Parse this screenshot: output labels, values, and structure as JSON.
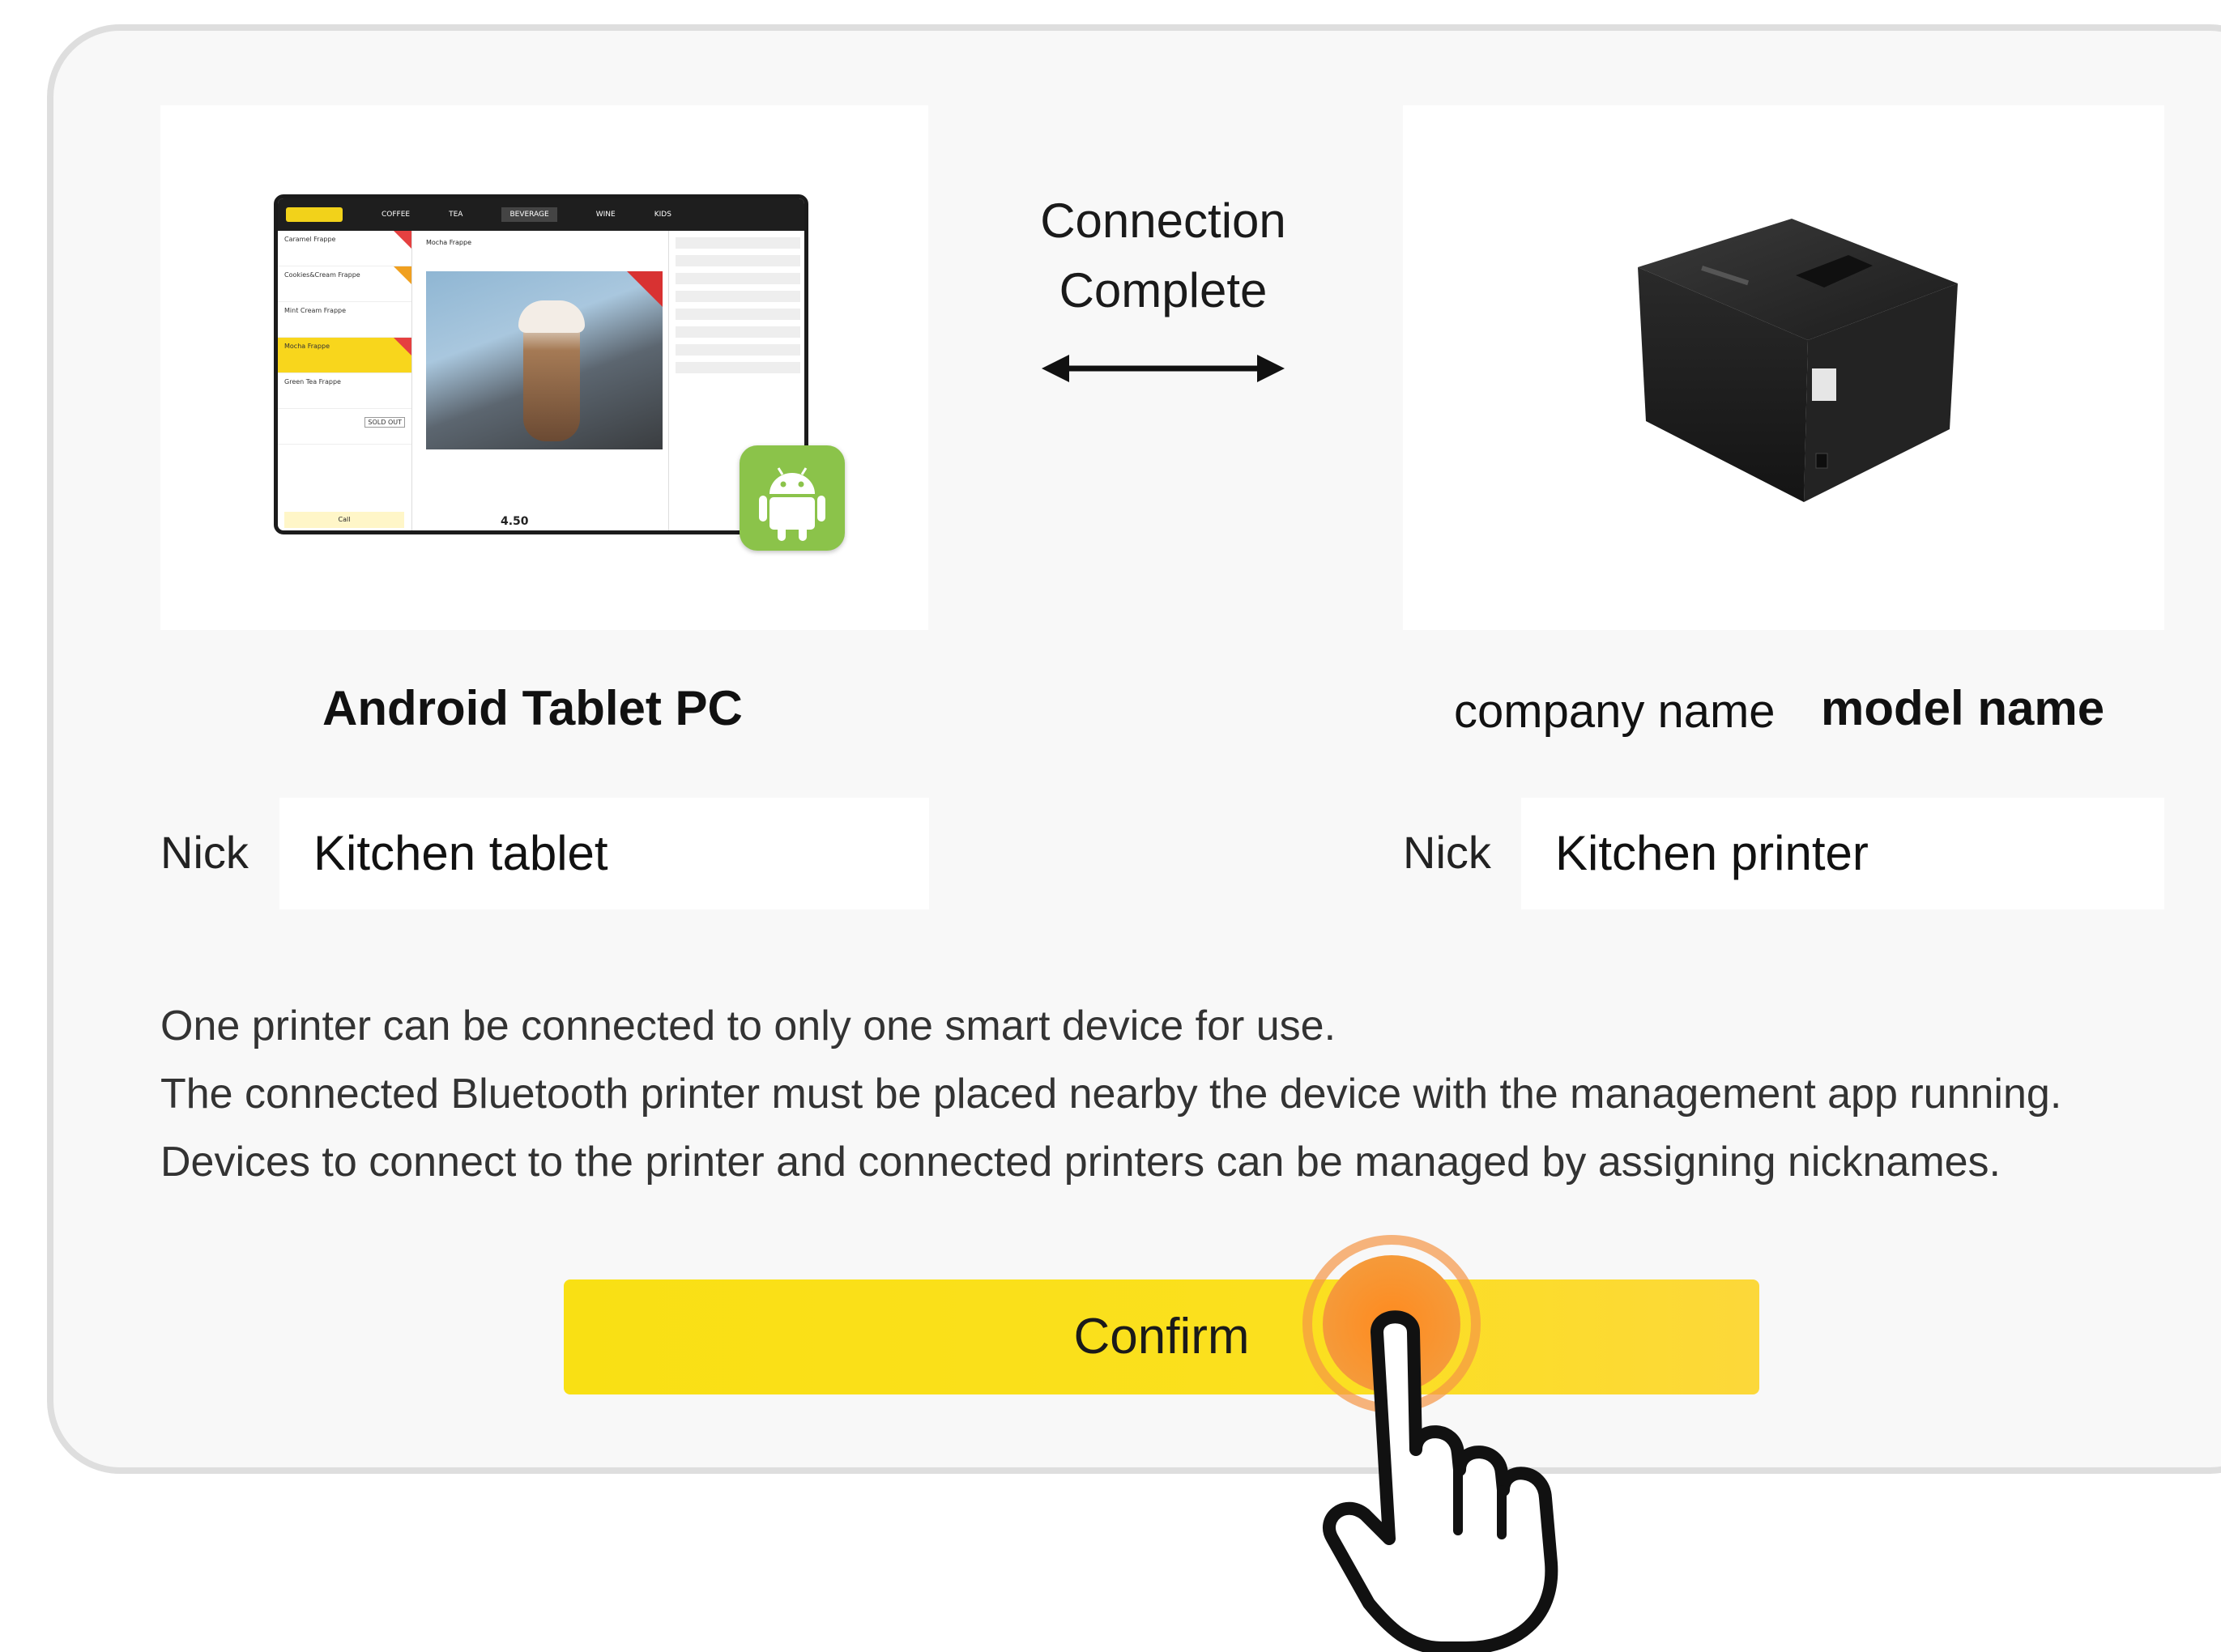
{
  "connection": {
    "line1": "Connection",
    "line2": "Complete"
  },
  "tablet": {
    "title": "Android Tablet PC",
    "nick_label": "Nick",
    "nick_value": "Kitchen tablet",
    "mockup": {
      "tabs": [
        "COFFEE",
        "TEA",
        "BEVERAGE",
        "WINE",
        "KIDS"
      ],
      "items": [
        "Caramel Frappe",
        "Cookies&Cream Frappe",
        "Mint Cream Frappe",
        "Mocha Frappe",
        "Green Tea Frappe"
      ],
      "sold_out": "SOLD OUT",
      "call": "Call",
      "detail_title": "Mocha Frappe",
      "price": "4.50"
    },
    "badge_icon": "android-icon"
  },
  "printer": {
    "company": "company name",
    "model": "model name",
    "nick_label": "Nick",
    "nick_value": "Kitchen printer"
  },
  "info_lines": [
    "One printer can be connected to only one smart device for use.",
    "The connected Bluetooth printer must be placed nearby the device with the management app running.",
    "Devices to connect to the printer and connected printers can be managed by assigning nicknames."
  ],
  "confirm_label": "Confirm",
  "colors": {
    "accent": "#f9e014",
    "tap": "#ff8a1e",
    "android": "#8bc34a"
  }
}
